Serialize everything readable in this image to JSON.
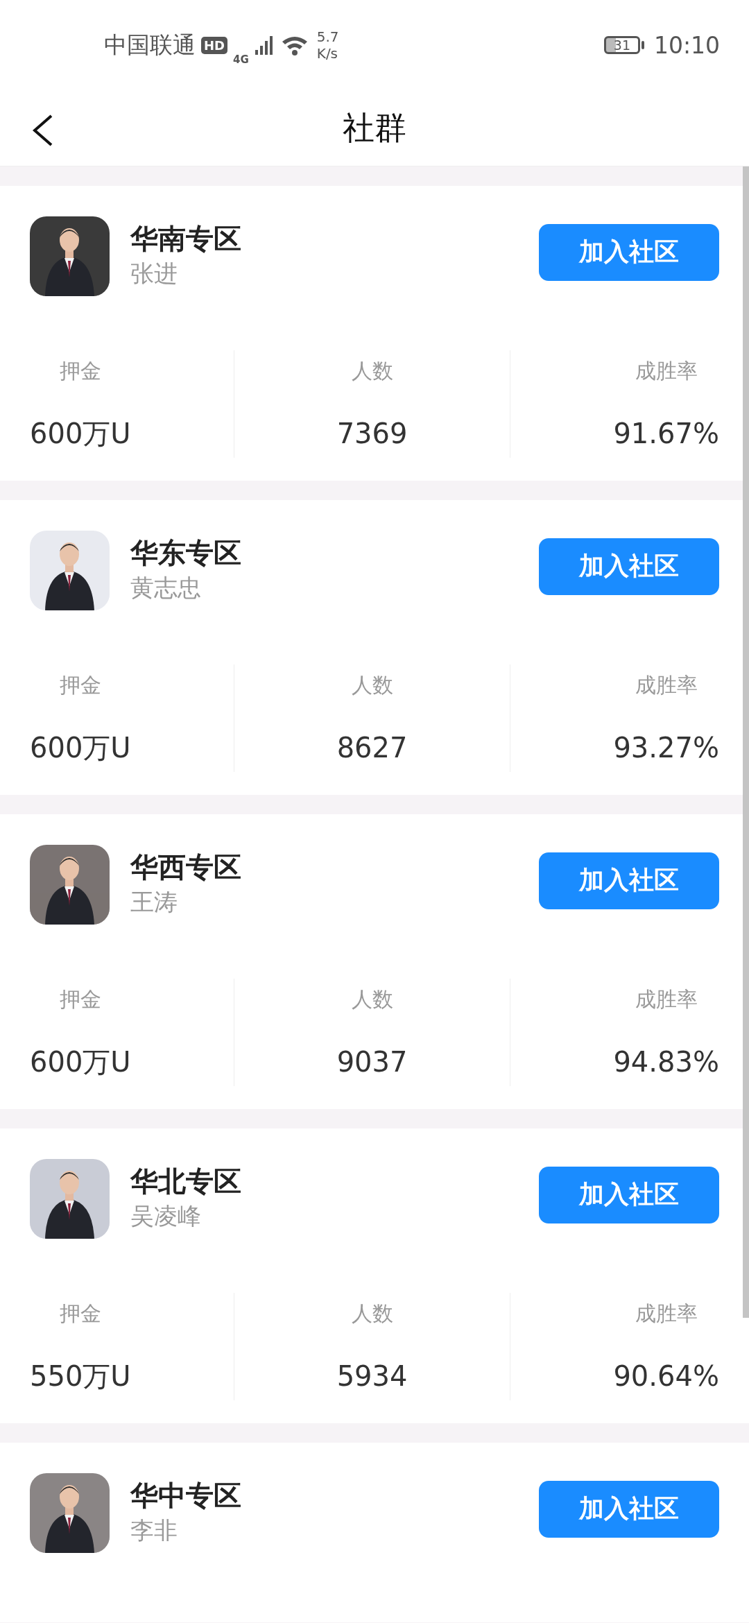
{
  "status_bar": {
    "carrier": "中国联通",
    "hd_badge": "HD",
    "network": "4G",
    "speed_value": "5.7",
    "speed_unit": "K/s",
    "battery": "31",
    "time": "10:10"
  },
  "header": {
    "title": "社群"
  },
  "communities": [
    {
      "title": "华南专区",
      "leader": "张进",
      "button": "加入社区",
      "stats": [
        {
          "label": "押金",
          "value": "600万U"
        },
        {
          "label": "人数",
          "value": "7369"
        },
        {
          "label": "成胜率",
          "value": "91.67%"
        }
      ]
    },
    {
      "title": "华东专区",
      "leader": "黄志忠",
      "button": "加入社区",
      "stats": [
        {
          "label": "押金",
          "value": "600万U"
        },
        {
          "label": "人数",
          "value": "8627"
        },
        {
          "label": "成胜率",
          "value": "93.27%"
        }
      ]
    },
    {
      "title": "华西专区",
      "leader": "王涛",
      "button": "加入社区",
      "stats": [
        {
          "label": "押金",
          "value": "600万U"
        },
        {
          "label": "人数",
          "value": "9037"
        },
        {
          "label": "成胜率",
          "value": "94.83%"
        }
      ]
    },
    {
      "title": "华北专区",
      "leader": "吴凌峰",
      "button": "加入社区",
      "stats": [
        {
          "label": "押金",
          "value": "550万U"
        },
        {
          "label": "人数",
          "value": "5934"
        },
        {
          "label": "成胜率",
          "value": "90.64%"
        }
      ]
    },
    {
      "title": "华中专区",
      "leader": "李非",
      "button": "加入社区"
    }
  ]
}
